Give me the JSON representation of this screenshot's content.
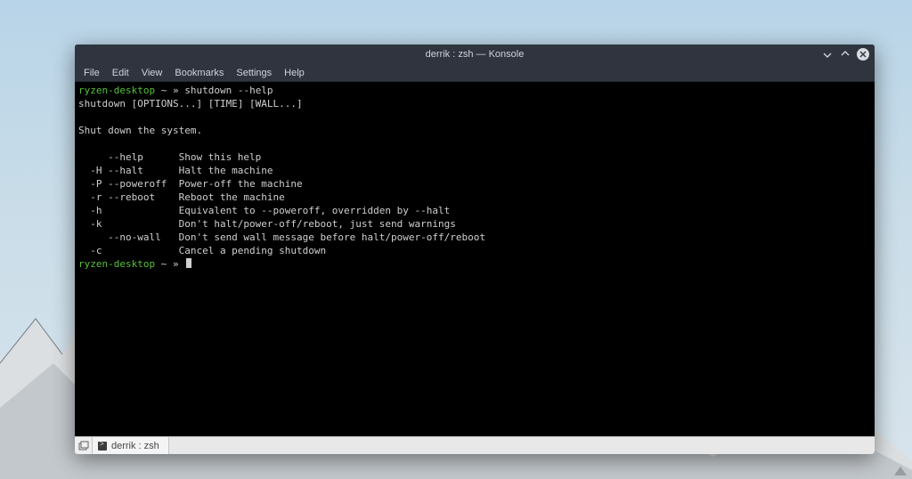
{
  "window": {
    "title": "derrik : zsh — Konsole"
  },
  "menubar": {
    "items": [
      "File",
      "Edit",
      "View",
      "Bookmarks",
      "Settings",
      "Help"
    ]
  },
  "terminal": {
    "prompt_host": "ryzen-desktop",
    "prompt_suffix": " ~ » ",
    "command1": "shutdown --help",
    "output": "shutdown [OPTIONS...] [TIME] [WALL...]\n\nShut down the system.\n\n     --help      Show this help\n  -H --halt      Halt the machine\n  -P --poweroff  Power-off the machine\n  -r --reboot    Reboot the machine\n  -h             Equivalent to --poweroff, overridden by --halt\n  -k             Don't halt/power-off/reboot, just send warnings\n     --no-wall   Don't send wall message before halt/power-off/reboot\n  -c             Cancel a pending shutdown"
  },
  "tabbar": {
    "tabs": [
      {
        "label": "derrik : zsh"
      }
    ]
  },
  "colors": {
    "prompt_green": "#57c038",
    "titlebar_bg": "#2f343f",
    "terminal_bg": "#000000",
    "terminal_fg": "#cfcfcf"
  }
}
